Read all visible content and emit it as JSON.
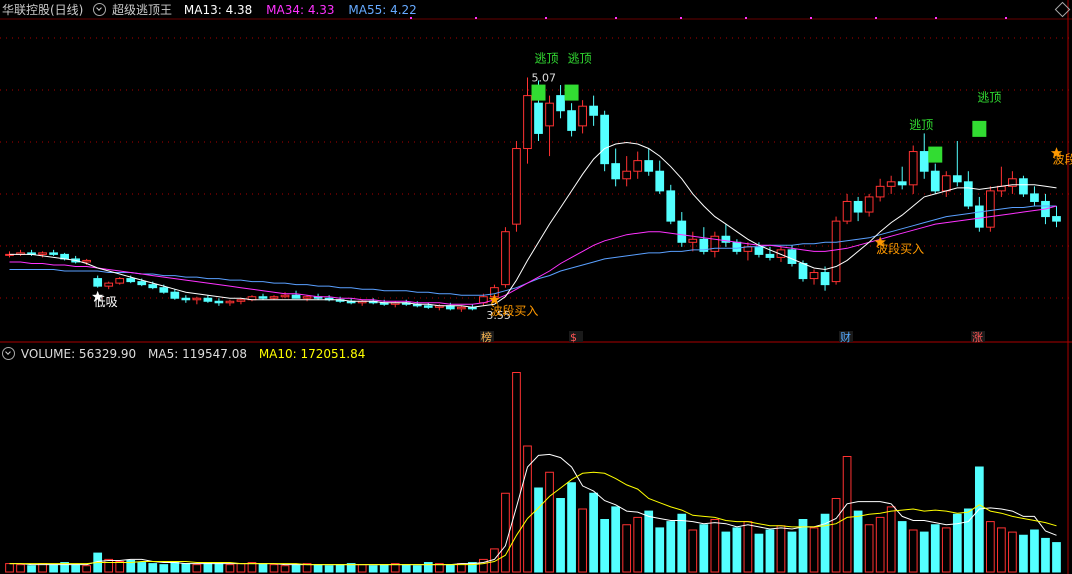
{
  "main_header": {
    "stock": "华联控股(日线)",
    "indicator": "超级逃顶王",
    "ma13_label": "MA13: 4.38",
    "ma34_label": "MA34: 4.33",
    "ma55_label": "MA55: 4.22"
  },
  "volume_header": {
    "volume_label": "VOLUME: 56329.90",
    "ma5_label": "MA5: 119547.08",
    "ma10_label": "MA10: 172051.84"
  },
  "colors": {
    "up": "#ff3232",
    "down": "#54ffff",
    "ma13": "#ffffff",
    "ma34": "#ff32ff",
    "ma55": "#5aa0ff",
    "signal": "#32dc32",
    "buy": "#ff9900",
    "volma10": "#ffff00",
    "grid": "#aa0000"
  },
  "chart_data": {
    "type": "candlestick",
    "price_range": [
      3.4,
      5.45
    ],
    "annotations_price": [
      "5.07",
      "3.55"
    ],
    "candles": [
      [
        3.9,
        3.92,
        3.88,
        3.9
      ],
      [
        3.9,
        3.93,
        3.89,
        3.91
      ],
      [
        3.91,
        3.93,
        3.89,
        3.9
      ],
      [
        3.9,
        3.92,
        3.88,
        3.91
      ],
      [
        3.91,
        3.93,
        3.89,
        3.9
      ],
      [
        3.9,
        3.91,
        3.86,
        3.87
      ],
      [
        3.87,
        3.89,
        3.84,
        3.85
      ],
      [
        3.85,
        3.87,
        3.83,
        3.86
      ],
      [
        3.74,
        3.76,
        3.68,
        3.69
      ],
      [
        3.69,
        3.72,
        3.67,
        3.71
      ],
      [
        3.71,
        3.75,
        3.7,
        3.74
      ],
      [
        3.74,
        3.76,
        3.71,
        3.72
      ],
      [
        3.72,
        3.74,
        3.69,
        3.7
      ],
      [
        3.7,
        3.72,
        3.67,
        3.68
      ],
      [
        3.68,
        3.7,
        3.64,
        3.65
      ],
      [
        3.65,
        3.67,
        3.6,
        3.61
      ],
      [
        3.61,
        3.63,
        3.58,
        3.6
      ],
      [
        3.6,
        3.62,
        3.57,
        3.61
      ],
      [
        3.61,
        3.63,
        3.58,
        3.59
      ],
      [
        3.59,
        3.61,
        3.56,
        3.58
      ],
      [
        3.58,
        3.6,
        3.56,
        3.59
      ],
      [
        3.59,
        3.61,
        3.57,
        3.6
      ],
      [
        3.6,
        3.63,
        3.59,
        3.62
      ],
      [
        3.62,
        3.64,
        3.6,
        3.61
      ],
      [
        3.61,
        3.63,
        3.6,
        3.62
      ],
      [
        3.62,
        3.65,
        3.61,
        3.63
      ],
      [
        3.63,
        3.66,
        3.62,
        3.61
      ],
      [
        3.61,
        3.63,
        3.59,
        3.62
      ],
      [
        3.62,
        3.64,
        3.6,
        3.61
      ],
      [
        3.61,
        3.63,
        3.59,
        3.6
      ],
      [
        3.6,
        3.62,
        3.58,
        3.59
      ],
      [
        3.59,
        3.61,
        3.57,
        3.58
      ],
      [
        3.58,
        3.6,
        3.56,
        3.59
      ],
      [
        3.59,
        3.61,
        3.57,
        3.58
      ],
      [
        3.58,
        3.6,
        3.56,
        3.57
      ],
      [
        3.57,
        3.59,
        3.55,
        3.58
      ],
      [
        3.58,
        3.6,
        3.56,
        3.57
      ],
      [
        3.57,
        3.59,
        3.55,
        3.56
      ],
      [
        3.56,
        3.58,
        3.54,
        3.55
      ],
      [
        3.55,
        3.57,
        3.53,
        3.56
      ],
      [
        3.56,
        3.58,
        3.53,
        3.54
      ],
      [
        3.54,
        3.56,
        3.52,
        3.55
      ],
      [
        3.55,
        3.57,
        3.53,
        3.54
      ],
      [
        3.58,
        3.64,
        3.56,
        3.62
      ],
      [
        3.62,
        3.7,
        3.6,
        3.68
      ],
      [
        3.7,
        4.08,
        3.68,
        4.05
      ],
      [
        4.1,
        4.65,
        4.05,
        4.6
      ],
      [
        4.6,
        5.07,
        4.5,
        4.95
      ],
      [
        4.9,
        5.05,
        4.65,
        4.7
      ],
      [
        4.75,
        4.95,
        4.55,
        4.9
      ],
      [
        4.95,
        5.02,
        4.8,
        4.85
      ],
      [
        4.85,
        4.9,
        4.68,
        4.72
      ],
      [
        4.75,
        4.92,
        4.7,
        4.88
      ],
      [
        4.88,
        4.95,
        4.75,
        4.82
      ],
      [
        4.82,
        4.85,
        4.45,
        4.5
      ],
      [
        4.5,
        4.6,
        4.35,
        4.4
      ],
      [
        4.4,
        4.55,
        4.35,
        4.45
      ],
      [
        4.45,
        4.58,
        4.4,
        4.52
      ],
      [
        4.52,
        4.6,
        4.42,
        4.45
      ],
      [
        4.45,
        4.52,
        4.3,
        4.32
      ],
      [
        4.32,
        4.36,
        4.1,
        4.12
      ],
      [
        4.12,
        4.18,
        3.95,
        3.98
      ],
      [
        3.98,
        4.05,
        3.92,
        4.0
      ],
      [
        4.0,
        4.08,
        3.9,
        3.92
      ],
      [
        3.92,
        4.05,
        3.88,
        4.02
      ],
      [
        4.02,
        4.1,
        3.95,
        3.98
      ],
      [
        3.98,
        4.0,
        3.9,
        3.92
      ],
      [
        3.92,
        3.98,
        3.86,
        3.95
      ],
      [
        3.95,
        3.98,
        3.88,
        3.9
      ],
      [
        3.9,
        3.95,
        3.86,
        3.88
      ],
      [
        3.88,
        3.95,
        3.85,
        3.93
      ],
      [
        3.93,
        3.96,
        3.82,
        3.84
      ],
      [
        3.84,
        3.86,
        3.72,
        3.74
      ],
      [
        3.74,
        3.8,
        3.7,
        3.78
      ],
      [
        3.78,
        3.82,
        3.66,
        3.7
      ],
      [
        3.72,
        4.15,
        3.7,
        4.12
      ],
      [
        4.12,
        4.3,
        4.1,
        4.25
      ],
      [
        4.25,
        4.28,
        4.12,
        4.18
      ],
      [
        4.18,
        4.3,
        4.15,
        4.28
      ],
      [
        4.28,
        4.4,
        4.25,
        4.35
      ],
      [
        4.35,
        4.42,
        4.3,
        4.38
      ],
      [
        4.38,
        4.48,
        4.33,
        4.36
      ],
      [
        4.36,
        4.62,
        4.3,
        4.58
      ],
      [
        4.58,
        4.7,
        4.4,
        4.45
      ],
      [
        4.45,
        4.5,
        4.3,
        4.32
      ],
      [
        4.32,
        4.45,
        4.28,
        4.42
      ],
      [
        4.42,
        4.65,
        4.35,
        4.38
      ],
      [
        4.38,
        4.45,
        4.2,
        4.22
      ],
      [
        4.22,
        4.28,
        4.05,
        4.08
      ],
      [
        4.08,
        4.35,
        4.05,
        4.32
      ],
      [
        4.32,
        4.48,
        4.28,
        4.35
      ],
      [
        4.35,
        4.45,
        4.3,
        4.4
      ],
      [
        4.4,
        4.42,
        4.28,
        4.3
      ],
      [
        4.3,
        4.35,
        4.22,
        4.25
      ],
      [
        4.25,
        4.3,
        4.1,
        4.15
      ],
      [
        4.15,
        4.22,
        4.08,
        4.12
      ]
    ],
    "ma13": [
      3.9,
      3.9,
      3.9,
      3.89,
      3.88,
      3.87,
      3.86,
      3.84,
      3.81,
      3.79,
      3.77,
      3.75,
      3.73,
      3.71,
      3.69,
      3.67,
      3.65,
      3.64,
      3.63,
      3.62,
      3.61,
      3.61,
      3.6,
      3.6,
      3.6,
      3.6,
      3.6,
      3.6,
      3.6,
      3.6,
      3.6,
      3.59,
      3.59,
      3.59,
      3.58,
      3.58,
      3.58,
      3.57,
      3.57,
      3.56,
      3.56,
      3.56,
      3.55,
      3.56,
      3.57,
      3.62,
      3.73,
      3.86,
      3.98,
      4.1,
      4.21,
      4.32,
      4.43,
      4.53,
      4.6,
      4.63,
      4.64,
      4.63,
      4.6,
      4.55,
      4.48,
      4.4,
      4.3,
      4.22,
      4.15,
      4.1,
      4.05,
      4.0,
      3.96,
      3.93,
      3.9,
      3.87,
      3.84,
      3.81,
      3.8,
      3.82,
      3.86,
      3.92,
      3.98,
      4.05,
      4.11,
      4.16,
      4.22,
      4.28,
      4.3,
      4.32,
      4.34,
      4.34,
      4.33,
      4.34,
      4.35,
      4.36,
      4.36,
      4.36,
      4.35,
      4.34
    ],
    "ma34": [
      3.85,
      3.85,
      3.84,
      3.84,
      3.83,
      3.83,
      3.82,
      3.82,
      3.81,
      3.8,
      3.79,
      3.78,
      3.77,
      3.76,
      3.75,
      3.74,
      3.73,
      3.72,
      3.71,
      3.7,
      3.69,
      3.68,
      3.67,
      3.66,
      3.65,
      3.64,
      3.64,
      3.63,
      3.62,
      3.62,
      3.61,
      3.61,
      3.6,
      3.6,
      3.59,
      3.59,
      3.59,
      3.58,
      3.58,
      3.58,
      3.57,
      3.57,
      3.57,
      3.58,
      3.6,
      3.63,
      3.67,
      3.71,
      3.75,
      3.79,
      3.84,
      3.88,
      3.92,
      3.96,
      3.99,
      4.01,
      4.03,
      4.04,
      4.05,
      4.05,
      4.04,
      4.03,
      4.02,
      4.01,
      4.0,
      3.99,
      3.98,
      3.97,
      3.96,
      3.96,
      3.95,
      3.94,
      3.93,
      3.92,
      3.92,
      3.93,
      3.94,
      3.96,
      3.98,
      4.0,
      4.02,
      4.04,
      4.06,
      4.08,
      4.1,
      4.11,
      4.12,
      4.13,
      4.14,
      4.15,
      4.16,
      4.17,
      4.18,
      4.19,
      4.2,
      4.22
    ],
    "ma55": [
      3.8,
      3.8,
      3.8,
      3.8,
      3.8,
      3.79,
      3.79,
      3.79,
      3.79,
      3.78,
      3.78,
      3.78,
      3.77,
      3.77,
      3.76,
      3.76,
      3.75,
      3.75,
      3.74,
      3.74,
      3.73,
      3.73,
      3.72,
      3.72,
      3.71,
      3.71,
      3.7,
      3.7,
      3.69,
      3.69,
      3.68,
      3.68,
      3.67,
      3.67,
      3.66,
      3.66,
      3.66,
      3.65,
      3.65,
      3.64,
      3.64,
      3.63,
      3.63,
      3.63,
      3.64,
      3.66,
      3.68,
      3.71,
      3.74,
      3.76,
      3.79,
      3.81,
      3.83,
      3.85,
      3.87,
      3.88,
      3.89,
      3.9,
      3.91,
      3.91,
      3.92,
      3.92,
      3.93,
      3.93,
      3.94,
      3.94,
      3.94,
      3.95,
      3.95,
      3.96,
      3.96,
      3.96,
      3.97,
      3.97,
      3.98,
      3.98,
      3.99,
      4.0,
      4.01,
      4.03,
      4.05,
      4.07,
      4.09,
      4.11,
      4.13,
      4.15,
      4.16,
      4.17,
      4.18,
      4.19,
      4.2,
      4.21,
      4.21,
      4.22,
      4.22,
      4.22
    ],
    "volume": [
      8,
      7,
      6,
      8,
      7,
      9,
      7,
      6,
      18,
      12,
      10,
      11,
      9,
      8,
      7,
      9,
      8,
      7,
      9,
      8,
      7,
      8,
      9,
      8,
      7,
      6,
      7,
      8,
      7,
      6,
      7,
      8,
      7,
      6,
      7,
      8,
      7,
      6,
      9,
      8,
      7,
      8,
      9,
      12,
      22,
      75,
      190,
      120,
      80,
      95,
      70,
      85,
      60,
      75,
      50,
      62,
      45,
      52,
      58,
      42,
      48,
      55,
      40,
      45,
      50,
      38,
      42,
      48,
      36,
      40,
      44,
      38,
      50,
      42,
      55,
      70,
      110,
      58,
      45,
      52,
      62,
      48,
      40,
      38,
      45,
      42,
      55,
      60,
      100,
      48,
      42,
      38,
      35,
      40,
      32,
      28
    ],
    "vol_ma5": [
      8,
      8,
      7,
      7,
      7,
      7,
      7,
      7,
      10,
      11,
      11,
      12,
      12,
      10,
      9,
      9,
      8,
      8,
      8,
      8,
      8,
      8,
      8,
      8,
      8,
      7,
      7,
      7,
      7,
      7,
      7,
      7,
      7,
      7,
      7,
      7,
      7,
      7,
      7,
      7,
      7,
      8,
      8,
      9,
      12,
      25,
      62,
      100,
      111,
      112,
      109,
      100,
      82,
      77,
      68,
      64,
      58,
      57,
      53,
      51,
      49,
      49,
      48,
      46,
      47,
      46,
      43,
      45,
      43,
      41,
      42,
      41,
      43,
      43,
      46,
      51,
      65,
      67,
      67,
      67,
      65,
      53,
      49,
      49,
      47,
      45,
      46,
      48,
      60,
      61,
      60,
      58,
      53,
      53,
      39,
      35
    ],
    "vol_ma10": [
      8,
      8,
      8,
      8,
      8,
      8,
      8,
      8,
      9,
      9,
      9,
      9,
      10,
      10,
      10,
      10,
      10,
      9,
      9,
      9,
      9,
      8,
      8,
      8,
      8,
      8,
      8,
      7,
      7,
      7,
      7,
      7,
      7,
      7,
      7,
      7,
      7,
      7,
      7,
      7,
      7,
      7,
      7,
      8,
      10,
      16,
      35,
      51,
      61,
      72,
      80,
      88,
      94,
      95,
      94,
      89,
      83,
      79,
      70,
      66,
      62,
      59,
      54,
      53,
      52,
      49,
      48,
      48,
      46,
      44,
      44,
      43,
      43,
      43,
      44,
      46,
      52,
      53,
      55,
      56,
      58,
      59,
      60,
      58,
      59,
      58,
      56,
      57,
      64,
      58,
      56,
      53,
      51,
      49,
      47,
      44
    ]
  },
  "markers": {
    "escape_text": "逃顶",
    "buy_text": "波段买入",
    "dip_text": "低吸",
    "bottom_tags": [
      "榜",
      "$",
      "财",
      "涨"
    ]
  }
}
